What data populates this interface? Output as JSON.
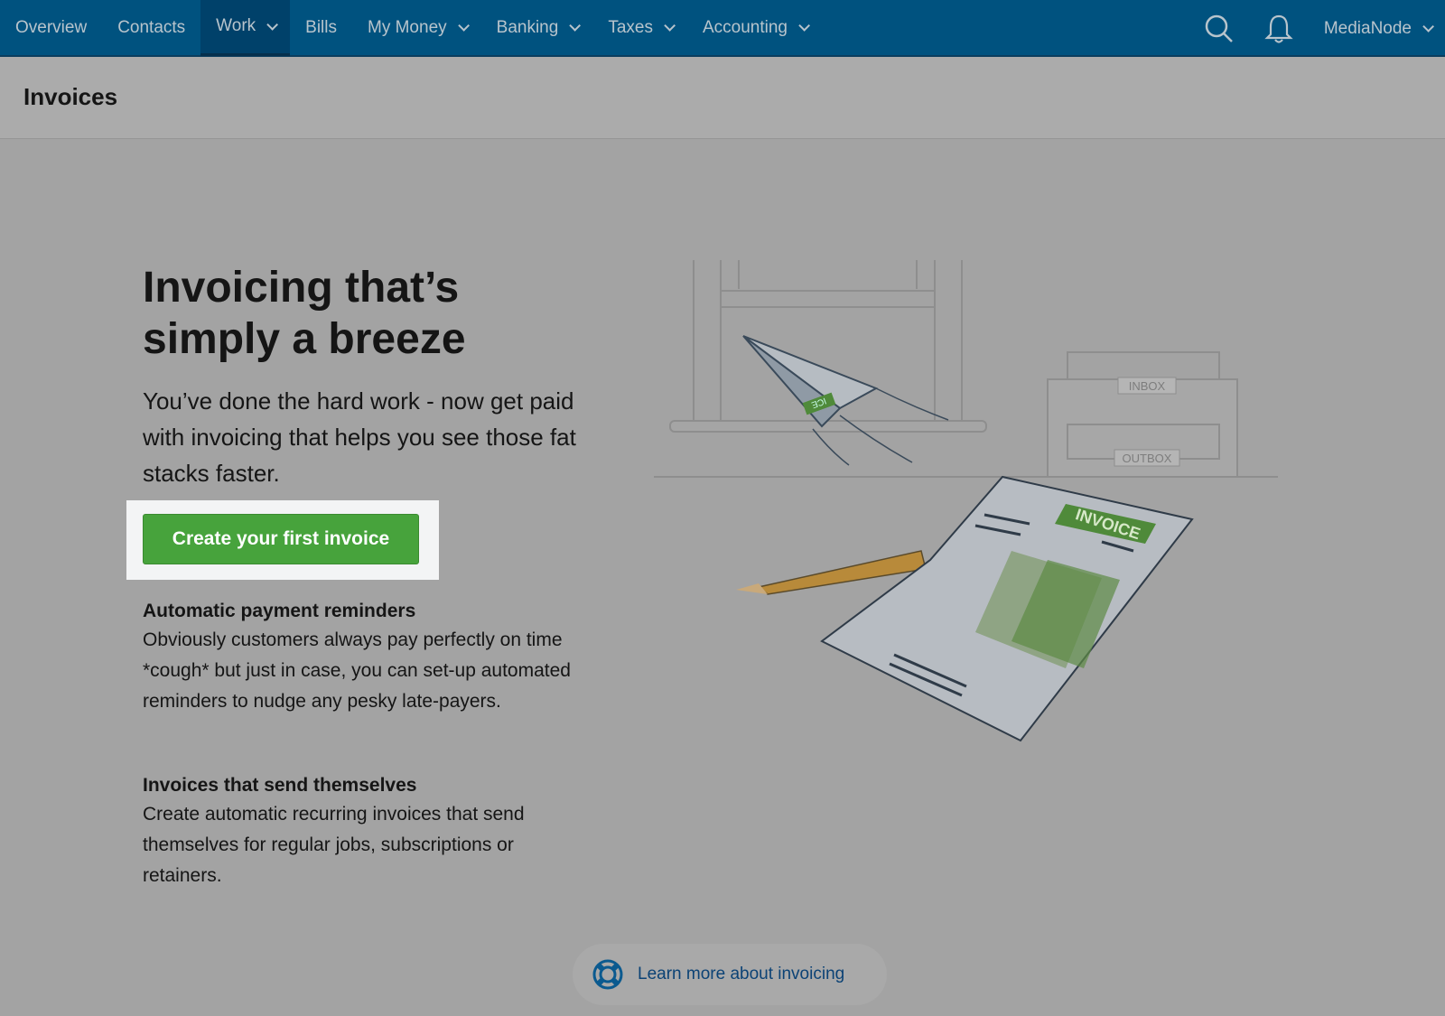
{
  "nav": {
    "items": [
      {
        "label": "Overview",
        "dropdown": false
      },
      {
        "label": "Contacts",
        "dropdown": false
      },
      {
        "label": "Work",
        "dropdown": true,
        "active": true
      },
      {
        "label": "Bills",
        "dropdown": false
      },
      {
        "label": "My Money",
        "dropdown": true
      },
      {
        "label": "Banking",
        "dropdown": true
      },
      {
        "label": "Taxes",
        "dropdown": true
      },
      {
        "label": "Accounting",
        "dropdown": true
      }
    ],
    "account": "MediaNode",
    "icons": [
      "search-icon",
      "bell-icon"
    ]
  },
  "header": {
    "title": "Invoices"
  },
  "hero": {
    "title_line1": "Invoicing that’s",
    "title_line2": "simply a breeze",
    "lead": "You’ve done the hard work - now get paid with invoicing that helps you see those fat stacks faster.",
    "cta": "Create your first invoice"
  },
  "features": [
    {
      "title": "Automatic payment reminders",
      "text": "Obviously customers always pay perfectly on time *cough* but just in case, you can set-up automated reminders to nudge any pesky late-payers."
    },
    {
      "title": "Invoices that send themselves",
      "text": "Create automatic recurring invoices that send themselves for regular jobs, subscriptions or retainers."
    }
  ],
  "illustration": {
    "inbox": "INBOX",
    "outbox": "OUTBOX",
    "invoice": "INVOICE",
    "plane": "ICE"
  },
  "learn_more": {
    "label": "Learn more about invoicing",
    "icon": "lifebuoy-icon"
  },
  "colors": {
    "nav": "#00527f",
    "cta": "#47a33c",
    "link": "#0b4275"
  }
}
